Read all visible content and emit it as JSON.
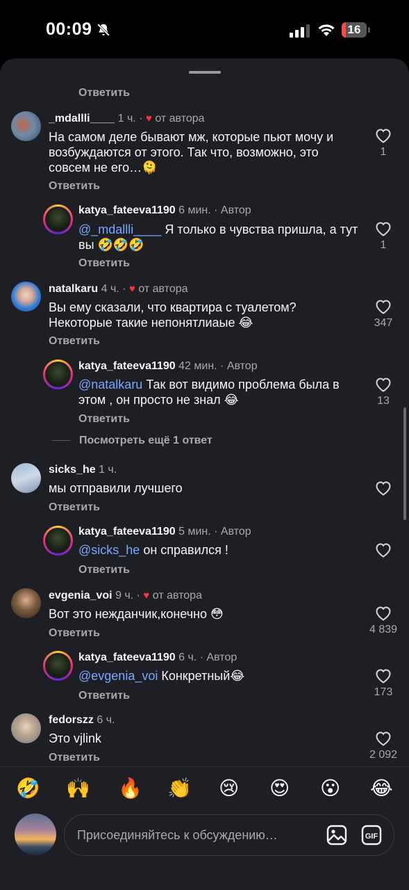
{
  "status": {
    "time": "00:09",
    "battery": "16",
    "battery_level": 0.16
  },
  "reply_label": "Ответить",
  "top_reply_label": "Ответить",
  "comments": [
    {
      "user": "_mdallli____",
      "time": "1 ч.",
      "author_like": "от автора",
      "text": "На самом деле бывают мж, которые пьют мочу и возбуждаются от этого. Так что, возможно, это совсем не его…🫠",
      "likes": "1"
    },
    {
      "user": "katya_fateeva1190",
      "time": "6 мин.",
      "author_tag": "Автор",
      "mention": "@_mdallli____",
      "text": " Я только в чувства пришла, а тут вы 🤣🤣🤣",
      "likes": "1"
    },
    {
      "user": "natalkaru",
      "time": "4 ч.",
      "author_like": "от автора",
      "text": "Вы ему сказали, что квартира с туалетом? Некоторые такие непонятлиаые 😂",
      "likes": "347"
    },
    {
      "user": "katya_fateeva1190",
      "time": "42 мин.",
      "author_tag": "Автор",
      "mention": "@natalkaru",
      "text": " Так вот видимо проблема была в этом , он просто не знал 😂",
      "likes": "13"
    },
    {
      "user": "sicks_he",
      "time": "1 ч.",
      "text": "мы отправили лучшего",
      "likes": ""
    },
    {
      "user": "katya_fateeva1190",
      "time": "5 мин.",
      "author_tag": "Автор",
      "mention": "@sicks_he",
      "text": " он справился !",
      "likes": ""
    },
    {
      "user": "evgenia_voi",
      "time": "9 ч.",
      "author_like": "от автора",
      "text": "Вот это нежданчик,конечно 😳",
      "likes": "4 839"
    },
    {
      "user": "katya_fateeva1190",
      "time": "6 ч.",
      "author_tag": "Автор",
      "mention": "@evgenia_voi",
      "text": " Конкретный😂",
      "likes": "173"
    },
    {
      "user": "fedorszz",
      "time": "6 ч.",
      "text": "Это vjlink",
      "likes": "2 092"
    }
  ],
  "more_replies": "Посмотреть ещё 1 ответ",
  "emojis": [
    "🤣",
    "🙌",
    "🔥",
    "👏",
    "😢",
    "😍",
    "😮",
    "😂"
  ],
  "composer": {
    "placeholder": "Присоединяйтесь к обсуждению…"
  },
  "colors": {
    "sheet": "#1e1f24",
    "mention": "#7aa6ff",
    "heart": "#ff3040"
  }
}
